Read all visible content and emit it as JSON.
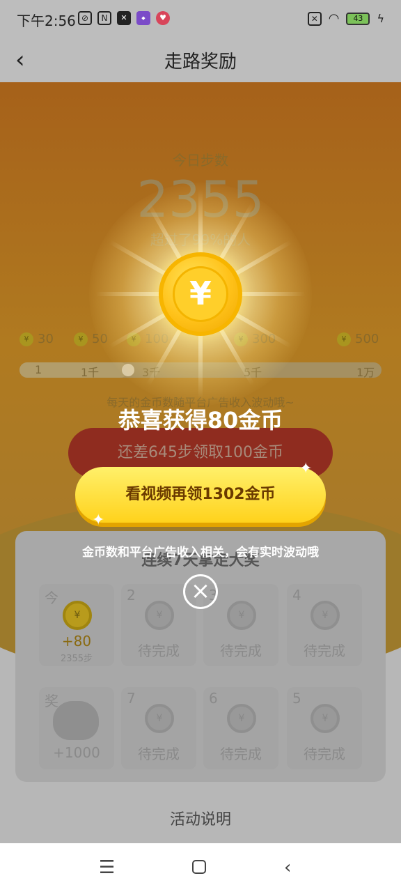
{
  "status_bar": {
    "time": "下午2:56",
    "battery": "43",
    "icons": [
      "mute-icon",
      "nfc-icon",
      "capcut-icon",
      "app-icon",
      "heart-app-icon",
      "sim-icon",
      "wifi-icon",
      "battery-icon",
      "charging-icon"
    ]
  },
  "nav": {
    "back_icon": "‹",
    "title": "走路奖励"
  },
  "steps": {
    "label": "今日步数",
    "value": "2355",
    "beat_text": "超过了99%的人"
  },
  "milestones": [
    {
      "reward": "30"
    },
    {
      "reward": "50"
    },
    {
      "reward": "100"
    },
    {
      "reward": "300"
    },
    {
      "reward": "500"
    }
  ],
  "progress": {
    "ticks": [
      "1",
      "1千",
      "3千",
      "5千",
      "1万"
    ],
    "fraction": 0.3
  },
  "fluct_note": "每天的金币数随平台广告收入波动哦~",
  "claim_button": "还差645步领取100金币",
  "streak": {
    "title": "连续7天拿走大奖",
    "today_corner": "今",
    "today_bonus": "+80",
    "today_steps": "2355步",
    "pending_label": "待完成",
    "bag_corner": "奖",
    "bag_bonus": "+1000",
    "days": [
      "2",
      "3",
      "4",
      "7",
      "6",
      "5"
    ]
  },
  "rules_link": "活动说明",
  "popup": {
    "coin_symbol": "¥",
    "congrats": "恭喜获得80金币",
    "video_button": "看视频再领1302金币",
    "note": "金币数和平台广告收入相关，会有实时波动哦",
    "close_icon": "×"
  },
  "colors": {
    "accent_yellow": "#ffd21c",
    "claim_red": "#8f2c1f",
    "coin_gold": "#ffc21a"
  }
}
